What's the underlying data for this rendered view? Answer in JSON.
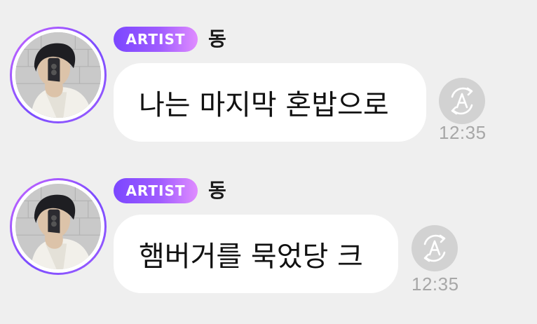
{
  "messages": [
    {
      "badge": "ARTIST",
      "sender": "동",
      "text": "나는 마지막 혼밥으로",
      "time": "12:35"
    },
    {
      "badge": "ARTIST",
      "sender": "동",
      "text": "햄버거를 묵었당 크",
      "time": "12:35"
    }
  ],
  "colors": {
    "background": "#efefef",
    "bubble": "#ffffff",
    "badge_gradient_start": "#7b47ff",
    "badge_gradient_end": "#e08cff",
    "avatar_ring": "#9d5dff",
    "translate_button": "#d2d2d2",
    "timestamp": "#a7a7a7"
  },
  "icons": {
    "translate": "translate-icon"
  }
}
